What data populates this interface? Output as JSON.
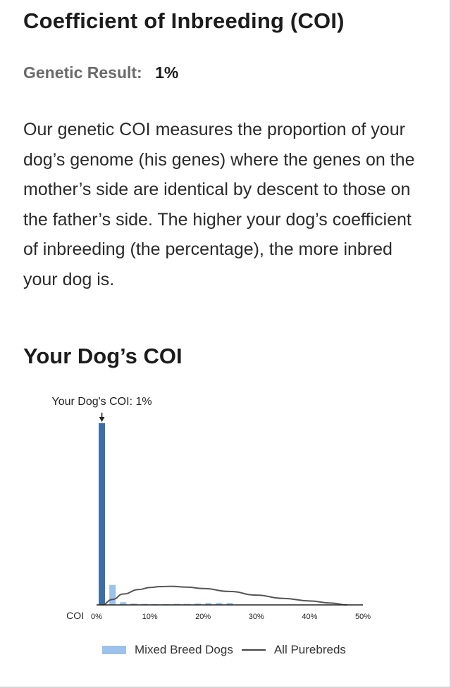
{
  "title": "Coefficient of Inbreeding (COI)",
  "result": {
    "label": "Genetic Result:",
    "value": "1%"
  },
  "description": "Our genetic COI measures the proportion of your dog’s genome (his genes) where the genes on the mother’s side are identical by descent to those on the father’s side. The higher your dog’s coefficient of inbreeding (the percentage), the more inbred your dog is.",
  "section_title": "Your Dog’s COI",
  "chart_data": {
    "type": "bar",
    "annotation": "Your Dog's COI: 1%",
    "marker_value": 1,
    "x_axis_label": "COI",
    "x_ticks": [
      "0%",
      "10%",
      "20%",
      "30%",
      "40%",
      "50%"
    ],
    "xlim": [
      0,
      50
    ],
    "highlight_bar": {
      "x": 1,
      "value": 100,
      "color": "#3c6ea6"
    },
    "series": [
      {
        "name": "Mixed Breed Dogs",
        "kind": "bar",
        "color": "#9cc1ea",
        "x": [
          3,
          5,
          7,
          9,
          11,
          13,
          15,
          17,
          19,
          21,
          23,
          25
        ],
        "values": [
          11,
          1.5,
          0.8,
          0.6,
          0.5,
          0.5,
          0.6,
          0.6,
          0.8,
          1.1,
          1.1,
          1.1
        ]
      },
      {
        "name": "All Purebreds",
        "kind": "line",
        "color": "#555555",
        "x": [
          1,
          3,
          5,
          8,
          10,
          12,
          14,
          17,
          20,
          25,
          30,
          35,
          40,
          44,
          47
        ],
        "y": [
          0,
          3,
          6,
          8.5,
          9.6,
          10.1,
          10.2,
          9.8,
          9.0,
          7.4,
          5.4,
          3.6,
          2.2,
          1.0,
          0
        ]
      }
    ],
    "ylim": [
      0,
      100
    ],
    "legend": [
      "Mixed Breed Dogs",
      "All Purebreds"
    ],
    "legend_position": "bottom"
  }
}
